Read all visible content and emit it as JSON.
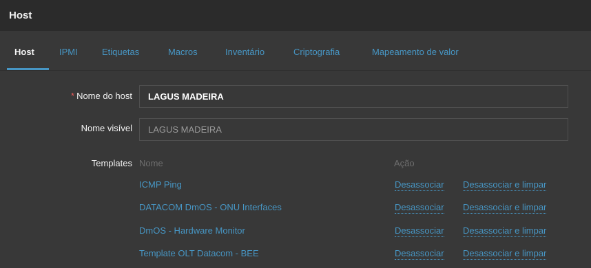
{
  "window": {
    "title": "Host"
  },
  "tabs": [
    {
      "label": "Host"
    },
    {
      "label": "IPMI"
    },
    {
      "label": "Etiquetas"
    },
    {
      "label": "Macros"
    },
    {
      "label": "Inventário"
    },
    {
      "label": "Criptografia"
    },
    {
      "label": "Mapeamento de valor"
    }
  ],
  "form": {
    "required_marker": "*",
    "hostname_label": "Nome do host",
    "hostname_value": "LAGUS MADEIRA",
    "visible_name_label": "Nome visível",
    "visible_name_value": "LAGUS MADEIRA",
    "templates_label": "Templates"
  },
  "templates_table": {
    "headers": {
      "name": "Nome",
      "action": "Ação"
    },
    "rows": [
      {
        "name": "ICMP Ping",
        "unlink": "Desassociar",
        "unlink_clear": "Desassociar e limpar"
      },
      {
        "name": "DATACOM DmOS - ONU Interfaces",
        "unlink": "Desassociar",
        "unlink_clear": "Desassociar e limpar"
      },
      {
        "name": "DmOS - Hardware Monitor",
        "unlink": "Desassociar",
        "unlink_clear": "Desassociar e limpar"
      },
      {
        "name": "Template OLT Datacom - BEE",
        "unlink": "Desassociar",
        "unlink_clear": "Desassociar e limpar"
      }
    ]
  },
  "colors": {
    "background": "#2b2b2b",
    "panel": "#383838",
    "link": "#4796c4",
    "text": "#f2f2f2",
    "required": "#e45959"
  }
}
